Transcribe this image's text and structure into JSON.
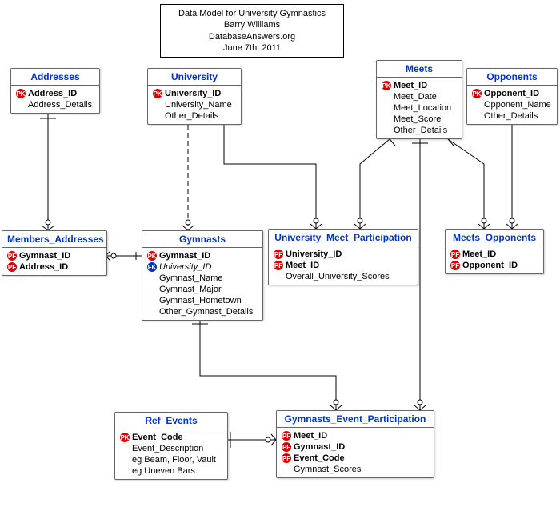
{
  "title": {
    "line1": "Data Model for University Gymnastics",
    "line2": "Barry Williams",
    "line3": "DatabaseAnswers.org",
    "line4": "June 7th. 2011"
  },
  "entities": {
    "addresses": {
      "name": "Addresses",
      "attrs": [
        {
          "key": "PK",
          "label": "Address_ID"
        },
        {
          "key": null,
          "label": "Address_Details"
        }
      ]
    },
    "university": {
      "name": "University",
      "attrs": [
        {
          "key": "PK",
          "label": "University_ID"
        },
        {
          "key": null,
          "label": "University_Name"
        },
        {
          "key": null,
          "label": "Other_Details"
        }
      ]
    },
    "meets": {
      "name": "Meets",
      "attrs": [
        {
          "key": "PK",
          "label": "Meet_ID"
        },
        {
          "key": null,
          "label": "Meet_Date"
        },
        {
          "key": null,
          "label": "Meet_Location"
        },
        {
          "key": null,
          "label": "Meet_Score"
        },
        {
          "key": null,
          "label": "Other_Details"
        }
      ]
    },
    "opponents": {
      "name": "Opponents",
      "attrs": [
        {
          "key": "PK",
          "label": "Opponent_ID"
        },
        {
          "key": null,
          "label": "Opponent_Name"
        },
        {
          "key": null,
          "label": "Other_Details"
        }
      ]
    },
    "members_addresses": {
      "name": "Members_Addresses",
      "attrs": [
        {
          "key": "PF",
          "label": "Gymnast_ID"
        },
        {
          "key": "PF",
          "label": "Address_ID"
        }
      ]
    },
    "gymnasts": {
      "name": "Gymnasts",
      "attrs": [
        {
          "key": "PK",
          "label": "Gymnast_ID"
        },
        {
          "key": "FK",
          "label": "University_ID",
          "italic": true
        },
        {
          "key": null,
          "label": "Gymnast_Name"
        },
        {
          "key": null,
          "label": "Gymnast_Major"
        },
        {
          "key": null,
          "label": "Gymnast_Hometown"
        },
        {
          "key": null,
          "label": "Other_Gymnast_Details"
        }
      ]
    },
    "ump": {
      "name": "University_Meet_Participation",
      "attrs": [
        {
          "key": "PF",
          "label": "University_ID"
        },
        {
          "key": "PF",
          "label": "Meet_ID"
        },
        {
          "key": null,
          "label": "Overall_University_Scores"
        }
      ]
    },
    "meets_opponents": {
      "name": "Meets_Opponents",
      "attrs": [
        {
          "key": "PF",
          "label": "Meet_ID"
        },
        {
          "key": "PF",
          "label": "Opponent_ID"
        }
      ]
    },
    "ref_events": {
      "name": "Ref_Events",
      "attrs": [
        {
          "key": "PK",
          "label": "Event_Code"
        },
        {
          "key": null,
          "label": "Event_Description"
        },
        {
          "key": null,
          "label": "eg Beam, Floor, Vault"
        },
        {
          "key": null,
          "label": "eg Uneven Bars"
        }
      ]
    },
    "gep": {
      "name": "Gymnasts_Event_Participation",
      "attrs": [
        {
          "key": "PF",
          "label": "Meet_ID"
        },
        {
          "key": "PF",
          "label": "Gymnast_ID"
        },
        {
          "key": "PF",
          "label": "Event_Code"
        },
        {
          "key": null,
          "label": "Gymnast_Scores"
        }
      ]
    }
  }
}
